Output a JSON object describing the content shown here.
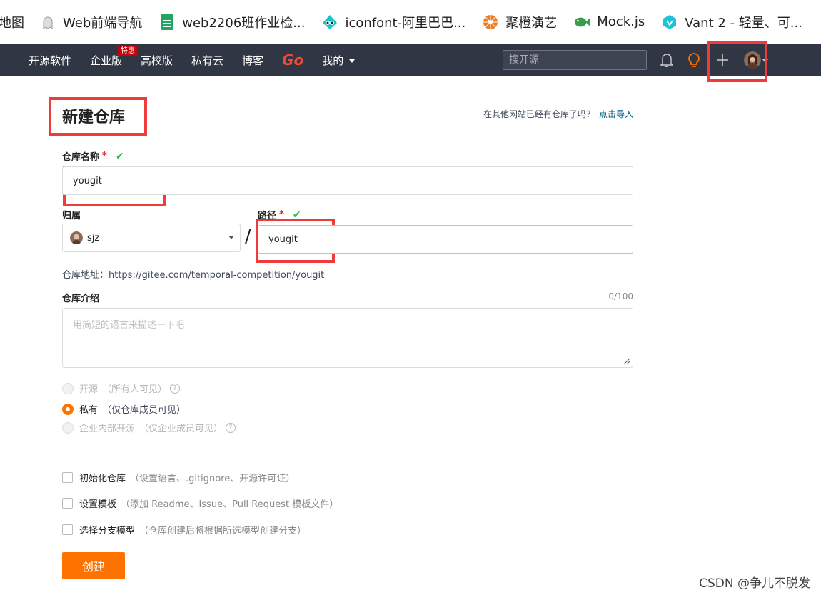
{
  "bookmarks": [
    {
      "label": "地图",
      "icon": "map-icon"
    },
    {
      "label": "Web前端导航",
      "icon": "ghost-icon"
    },
    {
      "label": "web2206班作业检...",
      "icon": "sheet-icon"
    },
    {
      "label": "iconfont-阿里巴巴...",
      "icon": "iconfont-icon"
    },
    {
      "label": "聚橙演艺",
      "icon": "orange-icon"
    },
    {
      "label": "Mock.js",
      "icon": "fish-icon"
    },
    {
      "label": "Vant 2 - 轻量、可...",
      "icon": "vant-icon"
    }
  ],
  "navbar": {
    "items": [
      "开源软件",
      "企业版",
      "高校版",
      "私有云",
      "博客"
    ],
    "badge": "特惠",
    "go": "Go",
    "mine": "我的",
    "search_placeholder": "搜开源"
  },
  "form": {
    "title": "新建仓库",
    "import_prompt": "在其他网站已经有仓库了吗？",
    "import_link": "点击导入",
    "repo_name_label": "仓库名称",
    "repo_name_value": "yougit",
    "owner_label": "归属",
    "owner_value": "sjz",
    "path_label": "路径",
    "path_value": "yougit",
    "slash": "/",
    "address": "仓库地址：https://gitee.com/temporal-competition/yougit",
    "intro_label": "仓库介绍",
    "intro_counter": "0/100",
    "intro_placeholder": "用简短的语言来描述一下吧",
    "required_mark": "*",
    "check_mark": "✔",
    "visibility": [
      {
        "label": "开源",
        "hint": "（所有人可见）",
        "selected": false,
        "disabled": true
      },
      {
        "label": "私有",
        "hint": "（仅仓库成员可见）",
        "selected": true,
        "disabled": false
      },
      {
        "label": "企业内部开源",
        "hint": "（仅企业成员可见）",
        "selected": false,
        "disabled": true
      }
    ],
    "options": [
      {
        "label": "初始化仓库",
        "hint": "（设置语言、.gitignore、开源许可证）"
      },
      {
        "label": "设置模板",
        "hint": "（添加 Readme、Issue、Pull Request 模板文件）"
      },
      {
        "label": "选择分支模型",
        "hint": "（仓库创建后将根据所选模型创建分支）"
      }
    ],
    "create_label": "创建"
  },
  "watermark": "CSDN @争儿不脱发",
  "colors": {
    "accent": "#fe7300",
    "navbar": "#303643",
    "highlight": "#ee3b3b"
  }
}
